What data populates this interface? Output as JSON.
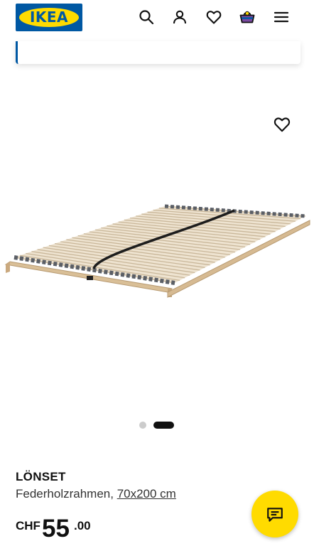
{
  "header": {
    "logo_text": "IKEA",
    "icons": [
      "search-icon",
      "user-icon",
      "heart-icon",
      "cart-icon",
      "menu-icon"
    ]
  },
  "gallery": {
    "image": "bed-slat-base-image",
    "dots_count": 2,
    "active_dot": 2
  },
  "product": {
    "name": "LÖNSET",
    "description": "Federholzrahmen, ",
    "size": "70x200 cm",
    "price": {
      "currency": "CHF",
      "integer": "55",
      "decimal": ".00"
    }
  },
  "colors": {
    "brand_blue": "#0058a3",
    "brand_yellow": "#ffdb00",
    "text": "#111111"
  },
  "chat": {
    "icon": "chat-icon"
  }
}
